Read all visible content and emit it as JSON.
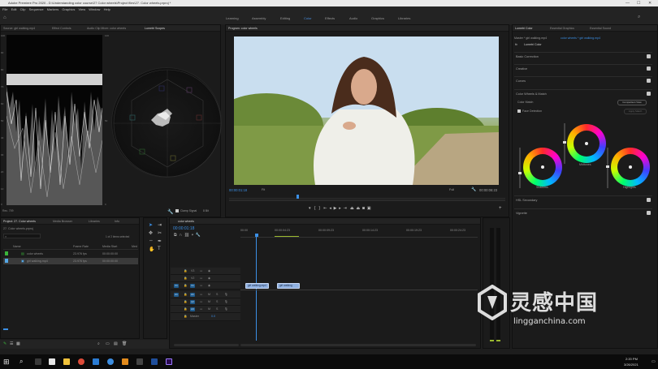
{
  "window": {
    "title": "Adobe Premiere Pro 2020 - D:\\Understanding color course\\27 Color wheels\\Project files\\27. Color wheels.prproj *"
  },
  "menu": [
    "File",
    "Edit",
    "Clip",
    "Sequence",
    "Markers",
    "Graphics",
    "View",
    "Window",
    "Help"
  ],
  "workspaces": [
    {
      "label": "Learning"
    },
    {
      "label": "Assembly"
    },
    {
      "label": "Editing"
    },
    {
      "label": "Color",
      "active": true
    },
    {
      "label": "Effects"
    },
    {
      "label": "Audio"
    },
    {
      "label": "Graphics"
    },
    {
      "label": "Libraries"
    }
  ],
  "scope_panel": {
    "tabs": [
      "Source: girl walking.mp4",
      "Effect Controls",
      "Audio Clip Mixer: color wheels",
      "Lumetri Scopes"
    ],
    "waveform_ticks": [
      "100",
      "90",
      "80",
      "70",
      "60",
      "50",
      "40",
      "30",
      "20",
      "10",
      "0"
    ],
    "footer_left": "Rec. 709",
    "clamp_label": "Clamp Signal",
    "bit_label": "8 Bit"
  },
  "program": {
    "tab": "Program: color wheels",
    "timecode": "00:00:01:18",
    "fit": "Fit",
    "quality": "Full",
    "duration": "00:00:06:23"
  },
  "lumetri": {
    "tabs": [
      "Lumetri Color",
      "Essential Graphics",
      "Essential Sound"
    ],
    "master": "Master * girl walking.mp4",
    "sequence": "color wheels * girl walking.mp4",
    "fx": "fx",
    "effect_name": "Lumetri Color",
    "sections": [
      "Basic Correction",
      "Creative",
      "Curves",
      "Color Wheels & Match",
      "HSL Secondary",
      "Vignette"
    ],
    "color_match": "Color Match",
    "comparison": "Comparison View",
    "face_detection": "Face Detection",
    "apply_match": "Apply Match",
    "wheels": [
      "Midtones",
      "Shadows",
      "Highlights"
    ]
  },
  "project": {
    "tabs": [
      "Project: 27. Color wheels",
      "Media Browser",
      "Libraries",
      "Info"
    ],
    "path": "27. Color wheels.prproj",
    "columns": [
      "Name",
      "Frame Rate",
      "Media Start",
      "Med"
    ],
    "items": [
      {
        "name": "color wheels",
        "rate": "23.976 fps",
        "start": "00:00:00:00",
        "color": "#3ab43a"
      },
      {
        "name": "girl walking.mp4",
        "rate": "23.976 fps",
        "start": "00:00:00:00",
        "color": "#55a8e6"
      }
    ],
    "selection": "1 of 2 items selected"
  },
  "timeline": {
    "tab": "color wheels",
    "timecode": "00:00:01:18",
    "ruler": [
      "00:00",
      "00:00:04:23",
      "00:00:09:23",
      "00:00:14:23",
      "00:00:19:23",
      "00:00:24:23"
    ],
    "video_tracks": [
      "V3",
      "V2",
      "V1"
    ],
    "audio_tracks": [
      "A1",
      "A2",
      "A3"
    ],
    "master": "Master",
    "master_value": "0.0",
    "clips": [
      "girl walking.mp4",
      "girl walking"
    ]
  },
  "watermark": {
    "text": "灵感中国",
    "url": "lingganchina.com"
  },
  "taskbar": {
    "time": "2:20 PM",
    "date": "3/26/2021"
  }
}
